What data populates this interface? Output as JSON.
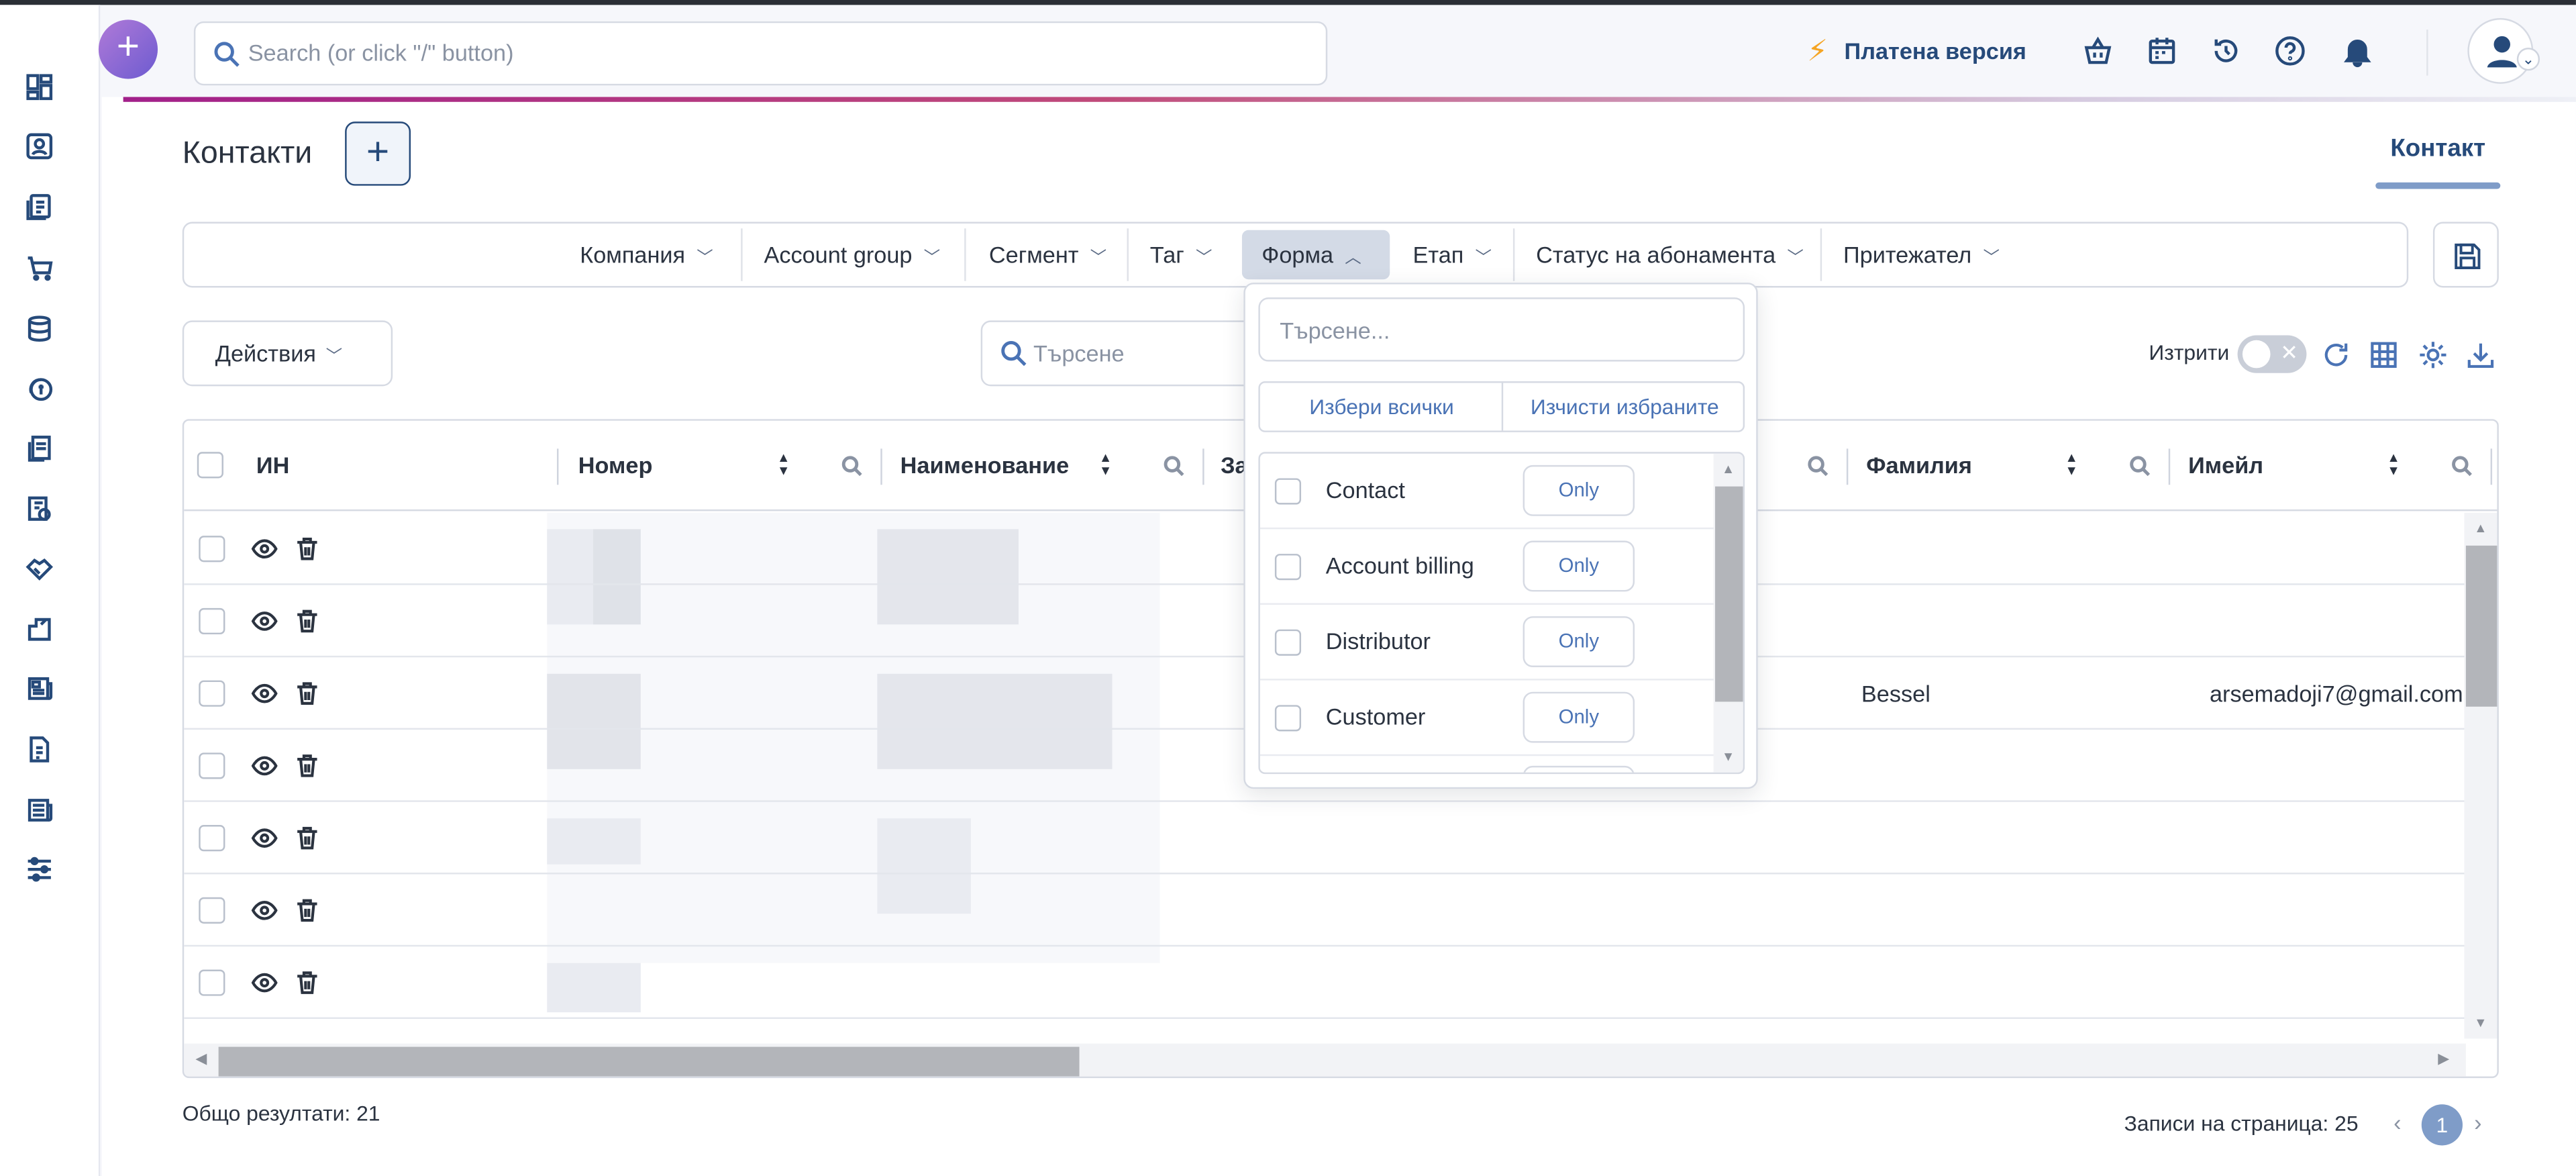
{
  "header": {
    "search_placeholder": "Search (or click \"/\" button)",
    "paid_version": "Платена версия"
  },
  "page": {
    "title": "Контакти",
    "tab_contact": "Контакт"
  },
  "filters": [
    {
      "label": "Компания"
    },
    {
      "label": "Account group"
    },
    {
      "label": "Сегмент"
    },
    {
      "label": "Таг"
    },
    {
      "label": "Форма"
    },
    {
      "label": "Етап"
    },
    {
      "label": "Статус на абонамента"
    },
    {
      "label": "Притежател"
    }
  ],
  "toolbar": {
    "actions": "Действия",
    "search_placeholder": "Търсене",
    "deleted_label": "Изтрити"
  },
  "table": {
    "columns": [
      {
        "label": "ИН"
      },
      {
        "label": "Номер"
      },
      {
        "label": "Наименование"
      },
      {
        "label": "За"
      },
      {
        "label": "Фамилия"
      },
      {
        "label": "Имейл"
      }
    ],
    "visible_row": {
      "last_name": "Bessel",
      "email": "arsemadoji7@gmail.com"
    }
  },
  "dropdown": {
    "search_placeholder": "Търсене...",
    "select_all": "Избери всички",
    "clear_selected": "Изчисти избраните",
    "items": [
      {
        "label": "Contact",
        "only": "Only"
      },
      {
        "label": "Account billing",
        "only": "Only"
      },
      {
        "label": "Distributor",
        "only": "Only"
      },
      {
        "label": "Customer",
        "only": "Only"
      }
    ]
  },
  "footer": {
    "total": "Общо резултати: 21",
    "per_page": "Записи на страница: 25",
    "current_page": "1"
  },
  "colors": {
    "brand": "#264a7a",
    "accent": "#7f9cc8"
  }
}
